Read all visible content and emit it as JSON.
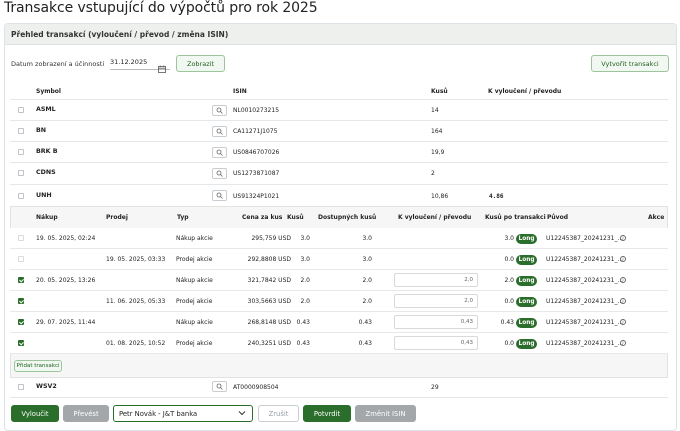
{
  "page": {
    "title": "Transakce vstupující do výpočtů pro rok 2025"
  },
  "panel": {
    "title": "Přehled transakcí (vyloučení / převod / změna ISIN)"
  },
  "filters": {
    "date_label": "Datum zobrazení a účinnosti",
    "date_value": "31.12.2025",
    "show_button": "Zobrazit",
    "create_button": "Vytvořit transakci"
  },
  "table": {
    "headers": {
      "symbol": "Symbol",
      "isin": "ISIN",
      "pieces": "Kusů",
      "exclusion": "K vyloučení / převodu"
    },
    "rows": [
      {
        "symbol": "ASML",
        "isin": "NL0010273215",
        "pieces": "14",
        "exclusion": ""
      },
      {
        "symbol": "BN",
        "isin": "CA11271J1075",
        "pieces": "164",
        "exclusion": ""
      },
      {
        "symbol": "BRK B",
        "isin": "US0846707026",
        "pieces": "19,9",
        "exclusion": ""
      },
      {
        "symbol": "CDNS",
        "isin": "US1273871087",
        "pieces": "2",
        "exclusion": ""
      },
      {
        "symbol": "UNH",
        "isin": "US91324P1021",
        "pieces": "10,86",
        "exclusion": "4.86"
      }
    ],
    "last_row": {
      "symbol": "WSV2",
      "isin": "AT0000908504",
      "pieces": "29"
    }
  },
  "detail": {
    "headers": {
      "buy": "Nákup",
      "sell": "Prodej",
      "type": "Typ",
      "price": "Cena za kus",
      "pieces": "Kusů",
      "available": "Dostupných kusů",
      "exclusion": "K vyloučení / převodu",
      "after": "Kusů po transakci",
      "origin": "Původ",
      "action": "Akce"
    },
    "rows": [
      {
        "checked": false,
        "buy": "19. 05. 2025, 02:24",
        "sell": "",
        "type": "Nákup akcie",
        "price": "295,759 USD",
        "pieces": "3.0",
        "available": "3.0",
        "exclusion": "",
        "after": "3.0",
        "badge": "Long",
        "origin": "U12245387_20241231_..."
      },
      {
        "checked": false,
        "buy": "",
        "sell": "19. 05. 2025, 03:33",
        "type": "Prodej akcie",
        "price": "292,8808 USD",
        "pieces": "3.0",
        "available": "3.0",
        "exclusion": "",
        "after": "0.0",
        "badge": "Long",
        "origin": "U12245387_20241231_..."
      },
      {
        "checked": true,
        "buy": "20. 05. 2025, 13:26",
        "sell": "",
        "type": "Nákup akcie",
        "price": "321,7842 USD",
        "pieces": "2.0",
        "available": "2.0",
        "exclusion": "2,0",
        "after": "2.0",
        "badge": "Long",
        "origin": "U12245387_20241231_..."
      },
      {
        "checked": true,
        "buy": "",
        "sell": "11. 06. 2025, 05:33",
        "type": "Prodej akcie",
        "price": "303,5663 USD",
        "pieces": "2.0",
        "available": "2.0",
        "exclusion": "2,0",
        "after": "0.0",
        "badge": "Long",
        "origin": "U12245387_20241231_..."
      },
      {
        "checked": true,
        "buy": "29. 07. 2025, 11:44",
        "sell": "",
        "type": "Nákup akcie",
        "price": "268,8148 USD",
        "pieces": "0.43",
        "available": "0.43",
        "exclusion": "0,43",
        "after": "0.43",
        "badge": "Long",
        "origin": "U12245387_20241231_..."
      },
      {
        "checked": true,
        "buy": "",
        "sell": "01. 08. 2025, 10:52",
        "type": "Prodej akcie",
        "price": "240,3251 USD",
        "pieces": "0.43",
        "available": "0.43",
        "exclusion": "0,43",
        "after": "0.0",
        "badge": "Long",
        "origin": "U12245387_20241231_..."
      }
    ],
    "add_button": "Přidat transakci"
  },
  "footer": {
    "exclude_button": "Vyloučit",
    "transfer_button": "Převést",
    "broker_select": "Petr Novák - J&T banka",
    "cancel_button": "Zrušit",
    "confirm_button": "Potvrdit",
    "change_isin_button": "Změnit ISIN"
  },
  "colors": {
    "primary": "#2b6e2b",
    "header_bg": "#eef0ee",
    "disabled": "#a4a7a9"
  }
}
